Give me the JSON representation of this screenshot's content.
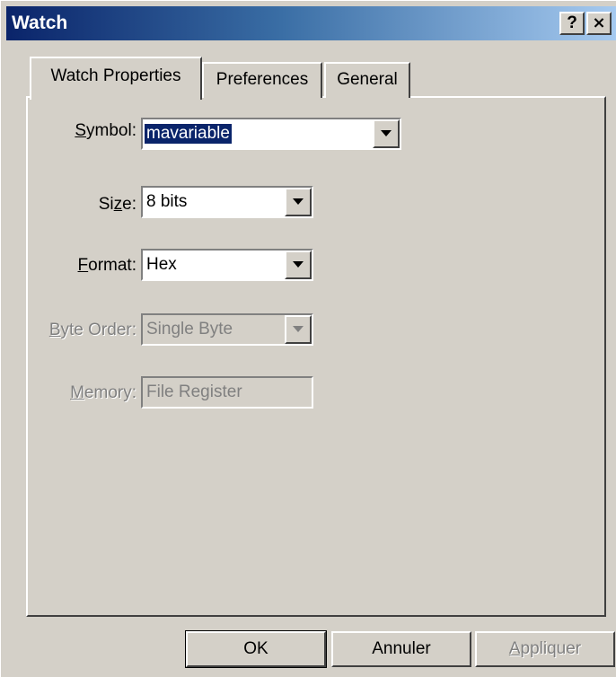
{
  "window": {
    "title": "Watch",
    "help_label": "?",
    "close_label": "×"
  },
  "tabs": [
    {
      "label": "Watch Properties",
      "active": true
    },
    {
      "label": "Preferences",
      "active": false
    },
    {
      "label": "General",
      "active": false
    }
  ],
  "fields": {
    "symbol": {
      "label_u": "S",
      "label_rest": "ymbol:",
      "value": "mavariable",
      "enabled": true
    },
    "size": {
      "label_pre": "Si",
      "label_u": "z",
      "label_rest": "e:",
      "value": "8 bits",
      "enabled": true
    },
    "format": {
      "label_u": "F",
      "label_rest": "ormat:",
      "value": "Hex",
      "enabled": true
    },
    "byte_order": {
      "label_u": "B",
      "label_rest": "yte Order:",
      "value": "Single Byte",
      "enabled": false
    },
    "memory": {
      "label_u": "M",
      "label_rest": "emory:",
      "value": "File Register",
      "enabled": false
    }
  },
  "buttons": {
    "ok": "OK",
    "cancel": "Annuler",
    "apply_u": "A",
    "apply_rest": "ppliquer"
  },
  "colors": {
    "face": "#d4d0c8",
    "title_start": "#0a246a",
    "title_end": "#a6caf0",
    "selection": "#0a246a",
    "disabled_text": "#808080"
  }
}
